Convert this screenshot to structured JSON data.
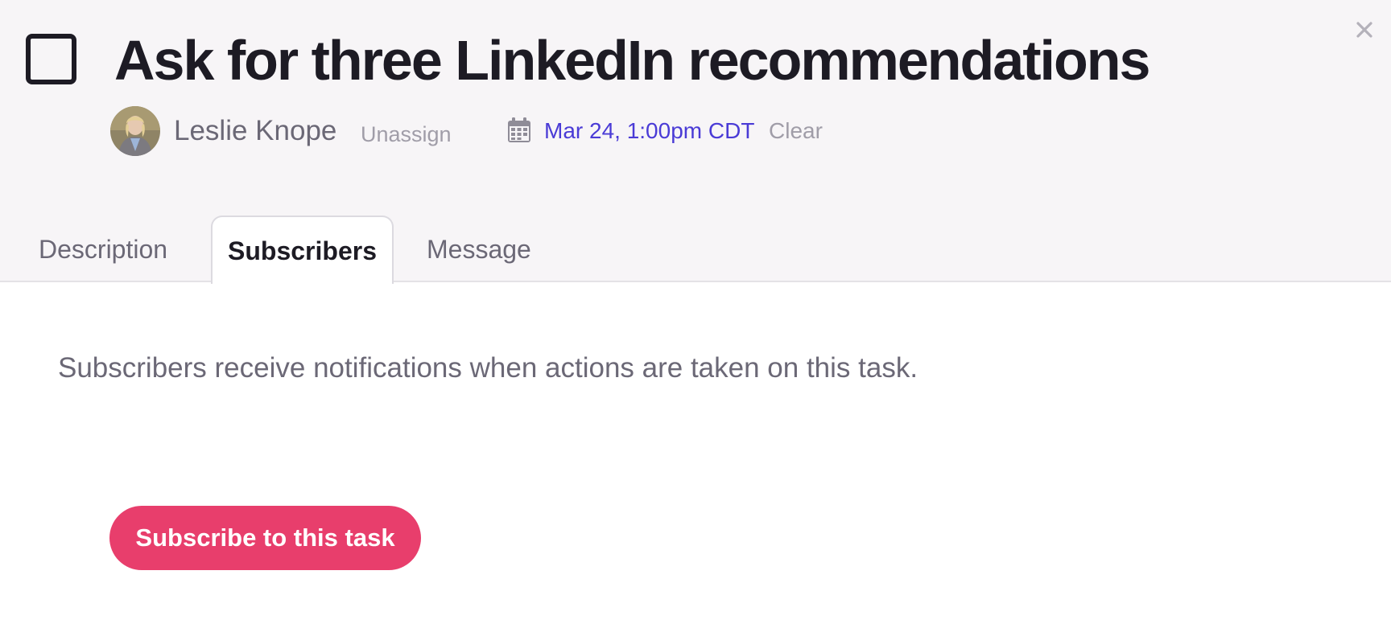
{
  "task": {
    "title": "Ask for three LinkedIn recommendations",
    "assignee": {
      "name": "Leslie Knope",
      "unassign_label": "Unassign"
    },
    "due": {
      "date": "Mar 24, 1:00pm CDT",
      "clear_label": "Clear"
    }
  },
  "tabs": [
    {
      "label": "Description",
      "active": false
    },
    {
      "label": "Subscribers",
      "active": true
    },
    {
      "label": "Message",
      "active": false
    }
  ],
  "subscribers": {
    "info": "Subscribers receive notifications when actions are taken on this task.",
    "button_label": "Subscribe to this task"
  },
  "icons": {
    "checkbox": "checkbox-unchecked-icon",
    "close": "close-icon",
    "calendar": "calendar-icon"
  },
  "colors": {
    "accent": "#4a3bd6",
    "primary_button": "#e83e6c",
    "header_bg": "#f7f5f7",
    "text_dark": "#1d1b24",
    "text_muted": "#6b6876"
  }
}
